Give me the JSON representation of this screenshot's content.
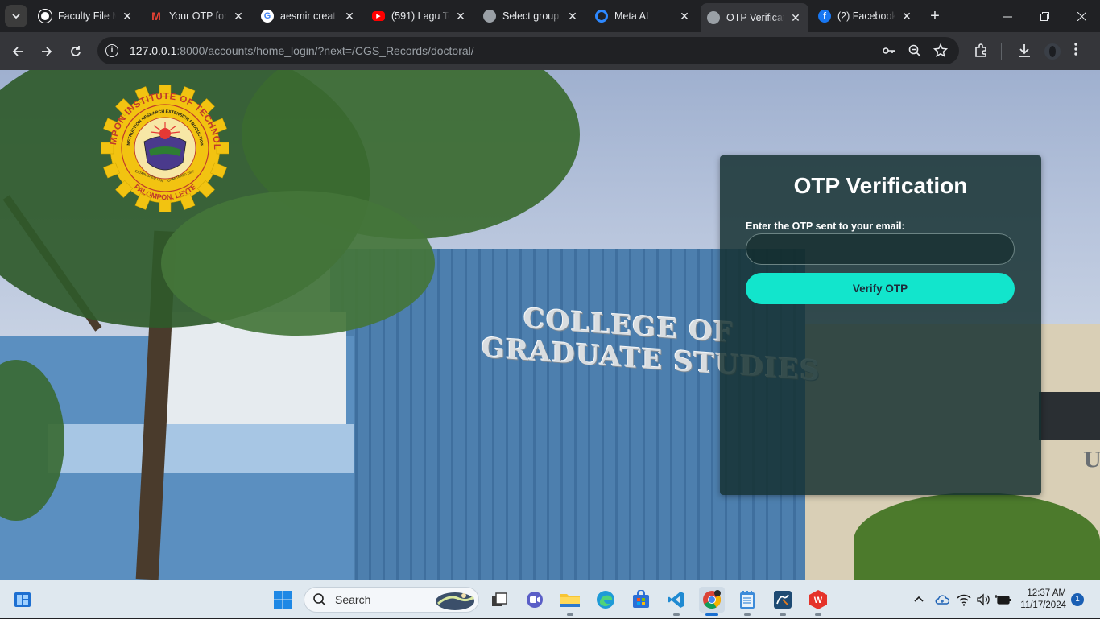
{
  "browser": {
    "tabs": [
      {
        "title": "Faculty File M",
        "favicon": "openai-icon",
        "color": "#ffffff"
      },
      {
        "title": "Your OTP for",
        "favicon": "gmail-icon",
        "color": "#ea4335"
      },
      {
        "title": "aesmir creat",
        "favicon": "google-icon",
        "color": "#4285f4"
      },
      {
        "title": "(591) Lagu Te",
        "favicon": "youtube-icon",
        "color": "#ff0000"
      },
      {
        "title": "Select group",
        "favicon": "globe-icon",
        "color": "#9aa0a6"
      },
      {
        "title": "Meta AI",
        "favicon": "meta-ai-icon",
        "color": "#2d88ff"
      },
      {
        "title": "OTP Verificat",
        "favicon": "globe-icon",
        "color": "#9aa0a6",
        "active": true
      },
      {
        "title": "(2) Facebook",
        "favicon": "facebook-icon",
        "color": "#1877f2"
      }
    ],
    "url_host": "127.0.0.1",
    "url_path": ":8000/accounts/home_login/?next=/CGS_Records/doctoral/"
  },
  "page": {
    "sign_line1": "COLLEGE OF",
    "sign_line2": "GRADUATE STUDIES",
    "logo": {
      "outer_text": "PALOMPON INSTITUTE OF TECHNOLOGY",
      "inner_text": "INSTRUCTION RESEARCH EXTENSION PRODUCTION",
      "bottom_text": "PALOMPON, LEYTE",
      "est": "ESTABLISHED 1964",
      "chartered": "CHARTERED 1977"
    },
    "right_building_text": "U"
  },
  "otp": {
    "title": "OTP Verification",
    "label": "Enter the OTP sent to your email:",
    "input_value": "",
    "button_label": "Verify OTP"
  },
  "taskbar": {
    "search_placeholder": "Search",
    "time": "12:37 AM",
    "date": "11/17/2024",
    "notification_count": "1"
  }
}
